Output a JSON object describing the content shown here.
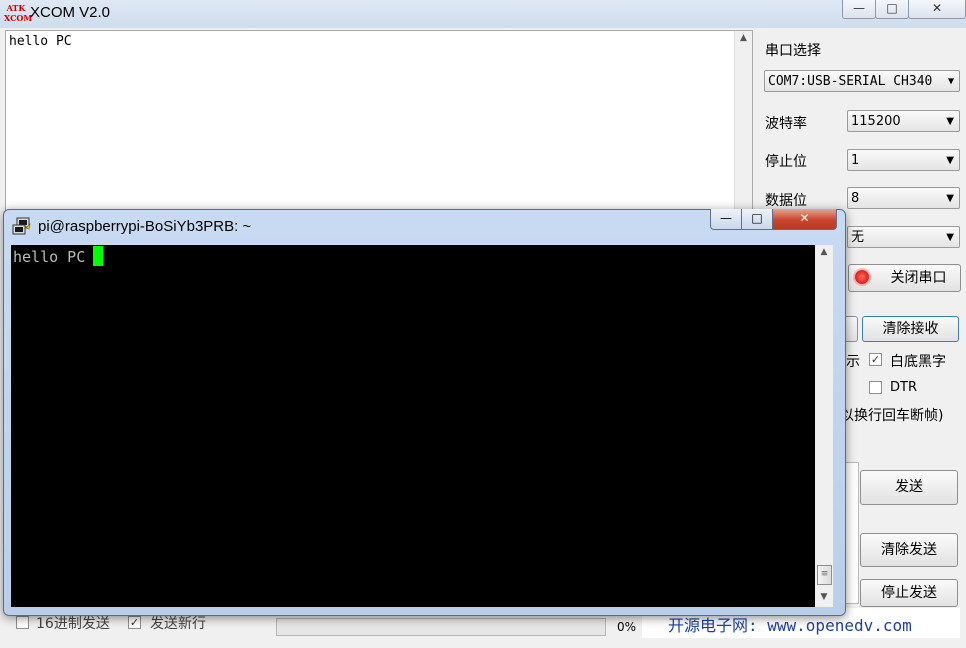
{
  "xcom": {
    "title": "XCOM V2.0",
    "logo_top": "ATK",
    "logo_bottom": "XCOM",
    "minimize_glyph": "—",
    "maximize_glyph": "□",
    "close_glyph": "✕",
    "receive_text": "hello PC",
    "port_label": "串口选择",
    "port_value": "COM7:USB-SERIAL CH340",
    "baud_label": "波特率",
    "baud_value": "115200",
    "stop_label": "停止位",
    "stop_value": "1",
    "data_label": "数据位",
    "data_value": "8",
    "parity_value": "无",
    "close_port_button": "关闭串口",
    "clear_receive_button": "清除接收",
    "hex_display_partial": "示",
    "white_bg_label": "白底黑字",
    "dtr_label": "DTR",
    "timestamp_partial": "以换行回车断帧)",
    "send_button": "发送",
    "clear_send_button": "清除发送",
    "stop_send_button": "停止发送",
    "hex_send_label": "16进制发送",
    "send_newline_label": "发送新行",
    "progress_text": "0%",
    "progress": 0,
    "footer_link": "开源电子网: www.openedv.com"
  },
  "putty": {
    "title": "pi@raspberrypi-BoSiYb3PRB: ~",
    "terminal_text": "hello PC",
    "minimize_glyph": "—",
    "maximize_glyph": "□",
    "close_glyph": "✕"
  },
  "colors": {
    "terminal_bg": "#000000",
    "terminal_text": "#bbbbbb",
    "cursor": "#00ff00",
    "close_button": "#c9452e",
    "link": "#1f3fa8"
  }
}
